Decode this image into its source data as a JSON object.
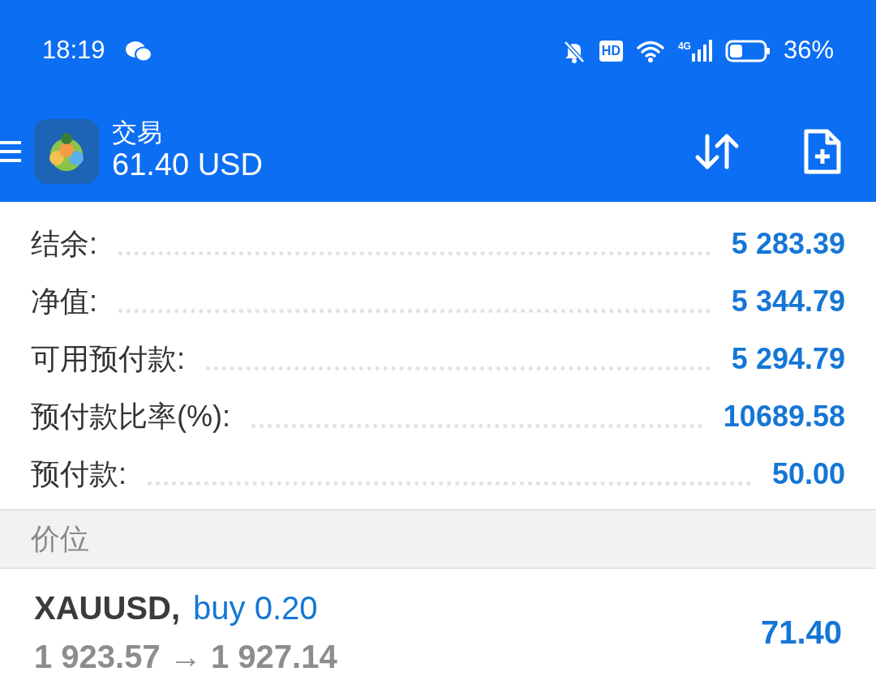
{
  "status_bar": {
    "time": "18:19",
    "hd_label": "HD",
    "network_label": "4G",
    "battery": "36%"
  },
  "toolbar": {
    "title": "交易",
    "subtitle": "61.40 USD"
  },
  "summary": [
    {
      "label": "结余:",
      "value": "5 283.39"
    },
    {
      "label": "净值:",
      "value": "5 344.79"
    },
    {
      "label": "可用预付款:",
      "value": "5 294.79"
    },
    {
      "label": "预付款比率(%):",
      "value": "10689.58"
    },
    {
      "label": "预付款:",
      "value": "50.00"
    }
  ],
  "section": {
    "title": "价位"
  },
  "positions": [
    {
      "symbol": "XAUUSD,",
      "type": "buy 0.20",
      "prices": "1 923.57 → 1 927.14",
      "profit": "71.40"
    }
  ]
}
